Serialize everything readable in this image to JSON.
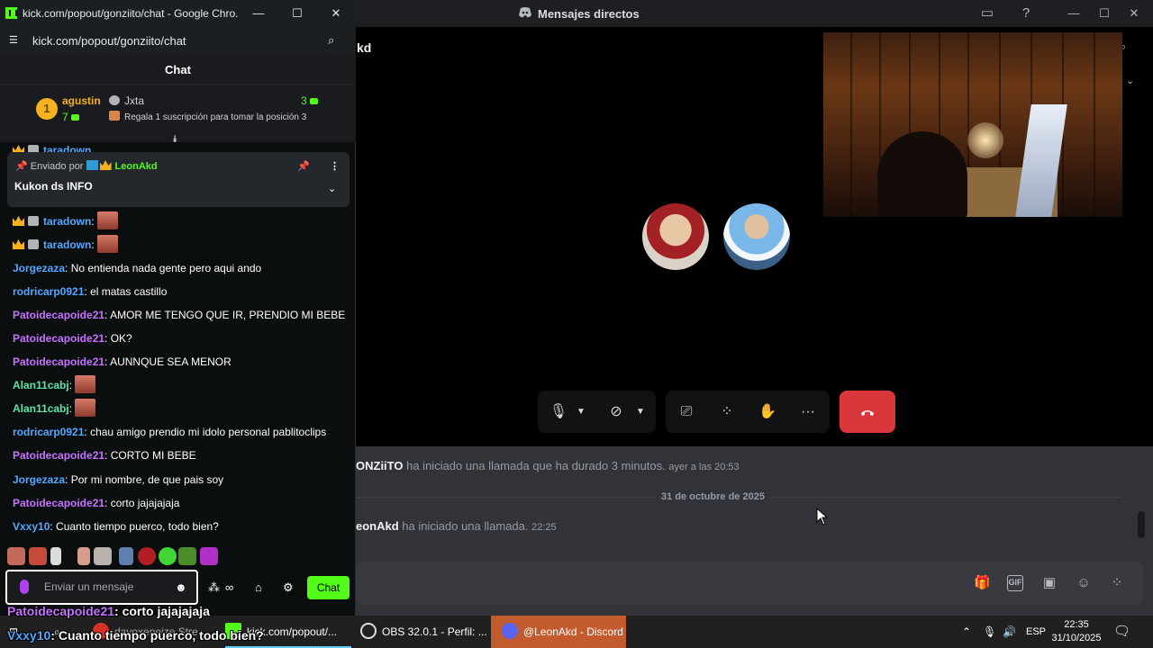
{
  "chrome": {
    "window_title": "kick.com/popout/gonziito/chat - Google Chro...",
    "url": "kick.com/popout/gonziito/chat"
  },
  "kick_chat": {
    "header_title": "Chat",
    "leaderboard": {
      "rank": "1",
      "first_user": "agustin",
      "first_count": "7",
      "second_user": "Jxta",
      "third_count": "3",
      "cta": "Regala 1 suscripción para tomar la posición 3"
    },
    "partial_line": "taradown",
    "pinned": {
      "sent_by_prefix": "Enviado por",
      "sent_by_user": "LeonAkd",
      "message": "Kukon ds INFO"
    },
    "messages": [
      {
        "user": "taradown",
        "text": "",
        "color": "#53a7ff",
        "badges": true,
        "emote": true
      },
      {
        "user": "taradown",
        "text": "",
        "color": "#53a7ff",
        "badges": true,
        "emote": true
      },
      {
        "user": "Jorgezaza",
        "text": "No entienda nada gente pero aqui ando",
        "color": "#53a7ff"
      },
      {
        "user": "rodricarp0921",
        "text": "el matas castillo",
        "color": "#53a7ff"
      },
      {
        "user": "Patoidecapoide21",
        "text": "AMOR ME TENGO QUE IR, PRENDIO MI BEBE",
        "color": "#c572ff"
      },
      {
        "user": "Patoidecapoide21",
        "text": "OK?",
        "color": "#c572ff"
      },
      {
        "user": "Patoidecapoide21",
        "text": "AUNNQUE SEA MENOR",
        "color": "#c572ff"
      },
      {
        "user": "Alan11cabj",
        "text": "",
        "color": "#5ce3a8",
        "emote": true
      },
      {
        "user": "Alan11cabj",
        "text": "",
        "color": "#5ce3a8",
        "emote": true
      },
      {
        "user": "rodricarp0921",
        "text": "chau amigo prendio mi idolo personal pablitoclips",
        "color": "#53a7ff"
      },
      {
        "user": "Patoidecapoide21",
        "text": "CORTO MI BEBE",
        "color": "#c572ff"
      },
      {
        "user": "Jorgezaza",
        "text": "Por mi nombre, de que pais soy",
        "color": "#53a7ff"
      },
      {
        "user": "Patoidecapoide21",
        "text": "corto jajajajaja",
        "color": "#c572ff"
      },
      {
        "user": "Vxxy10",
        "text": "Cuanto tiempo puerco, todo bien?",
        "color": "#53a7ff"
      }
    ],
    "input_placeholder": "Enviar un mensaje",
    "send_label": "Chat"
  },
  "discord": {
    "window_title": "Mensajes directos",
    "partial_name": "kd",
    "call_log": [
      {
        "name": "ONZiiTO",
        "text": "ha iniciado una llamada que ha durado 3 minutos.",
        "time": "ayer a las 20:53"
      },
      {
        "name": "eonAkd",
        "text": "ha iniciado una llamada.",
        "time": "22:25"
      }
    ],
    "date_divider": "31 de octubre de 2025"
  },
  "overlay": {
    "line1_user": "Patoidecapoide21",
    "line1_text": ": corto jajajajaja",
    "line2_user": "Vxxy10",
    "line2_text": ": Cuanto tiempo puerco, todo bien?"
  },
  "taskbar": {
    "items": [
      {
        "label": "kick.com/popout/..."
      },
      {
        "label": "OBS 32.0.1 - Perfil: ..."
      },
      {
        "label": "@LeonAkd - Discord"
      }
    ],
    "partial_item": "davoxeneize Stre...",
    "language": "ESP",
    "time": "22:35",
    "date": "31/10/2025"
  },
  "colors": {
    "kick_green": "#53fc18",
    "discord_hangup": "#da373c",
    "taskbar_active": "#c25b2d"
  }
}
